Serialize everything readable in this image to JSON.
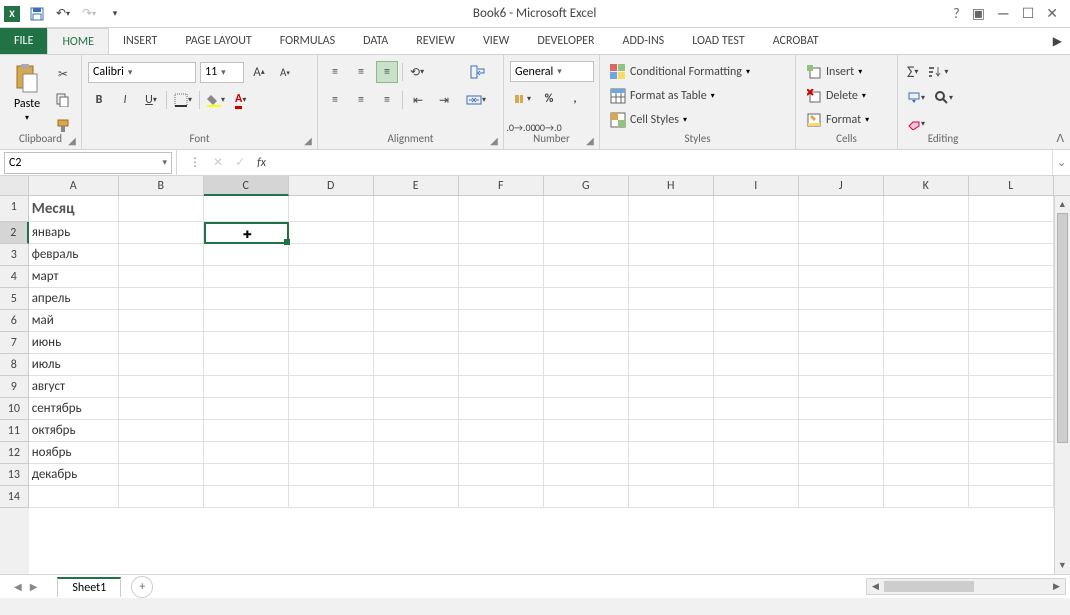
{
  "title": "Book6 - Microsoft Excel",
  "tabs": {
    "file": "FILE",
    "home": "HOME",
    "insert": "INSERT",
    "page": "PAGE LAYOUT",
    "formulas": "FORMULAS",
    "data": "DATA",
    "review": "REVIEW",
    "view": "VIEW",
    "developer": "DEVELOPER",
    "addins": "ADD-INS",
    "loadtest": "LOAD TEST",
    "acrobat": "ACROBAT"
  },
  "ribbon": {
    "clipboard": {
      "label": "Clipboard",
      "paste": "Paste"
    },
    "font": {
      "label": "Font",
      "name": "Calibri",
      "size": "11"
    },
    "alignment": {
      "label": "Alignment"
    },
    "number": {
      "label": "Number",
      "format": "General"
    },
    "styles": {
      "label": "Styles",
      "conditional": "Conditional Formatting",
      "table": "Format as Table",
      "cell": "Cell Styles"
    },
    "cells": {
      "label": "Cells",
      "insert": "Insert",
      "delete": "Delete",
      "format": "Format"
    },
    "editing": {
      "label": "Editing"
    }
  },
  "namebox": "C2",
  "columns": [
    "A",
    "B",
    "C",
    "D",
    "E",
    "F",
    "G",
    "H",
    "I",
    "J",
    "K",
    "L"
  ],
  "rows": [
    "1",
    "2",
    "3",
    "4",
    "5",
    "6",
    "7",
    "8",
    "9",
    "10",
    "11",
    "12",
    "13",
    "14"
  ],
  "cellA1": "Месяц",
  "data_A": [
    "январь",
    "февраль",
    "март",
    "апрель",
    "май",
    "июнь",
    "июль",
    "август",
    "сентябрь",
    "октябрь",
    "ноябрь",
    "декабрь"
  ],
  "sheet": "Sheet1"
}
